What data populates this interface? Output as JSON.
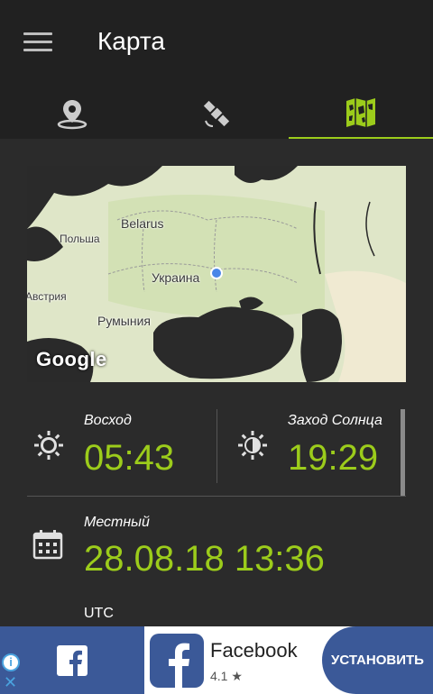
{
  "app": {
    "title": "Карта",
    "tabs": [
      {
        "name": "location",
        "icon": "location-pin-icon",
        "active": false
      },
      {
        "name": "satellite",
        "icon": "satellite-icon",
        "active": false
      },
      {
        "name": "map",
        "icon": "map-icon",
        "active": true
      }
    ]
  },
  "map": {
    "labels": {
      "belarus": "Belarus",
      "poland": "Польша",
      "ukraine": "Украина",
      "austria": "Австрия",
      "romania": "Румыния"
    },
    "provider": "Google"
  },
  "sun": {
    "sunrise_label": "Восход",
    "sunrise_time": "05:43",
    "sunset_label": "Заход Солнца",
    "sunset_time": "19:29"
  },
  "local": {
    "label": "Местный",
    "datetime": "28.08.18 13:36",
    "next_label_partial": "UTC"
  },
  "ad": {
    "app_name": "Facebook",
    "rating": "4.1 ★",
    "install_label": "УСТАНОВИТЬ",
    "close_glyph": "✕",
    "info_glyph": "i"
  },
  "colors": {
    "accent": "#9ccc1b",
    "appbar": "#212121",
    "background": "#2b2b2b",
    "facebook": "#3b5998"
  }
}
